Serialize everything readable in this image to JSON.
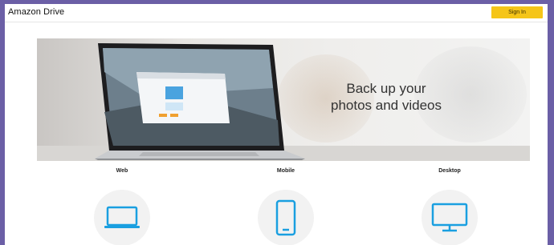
{
  "header": {
    "brand": "Amazon Drive",
    "sign_in_label": "Sign In"
  },
  "hero": {
    "headline_line1": "Back up your",
    "headline_line2": "photos and videos"
  },
  "platforms": [
    {
      "label": "Web",
      "icon": "laptop-icon"
    },
    {
      "label": "Mobile",
      "icon": "smartphone-icon"
    },
    {
      "label": "Desktop",
      "icon": "desktop-monitor-icon"
    }
  ],
  "colors": {
    "accent": "#f5c518",
    "icon_blue": "#1a9fe0",
    "frame": "#6b5fa6"
  }
}
